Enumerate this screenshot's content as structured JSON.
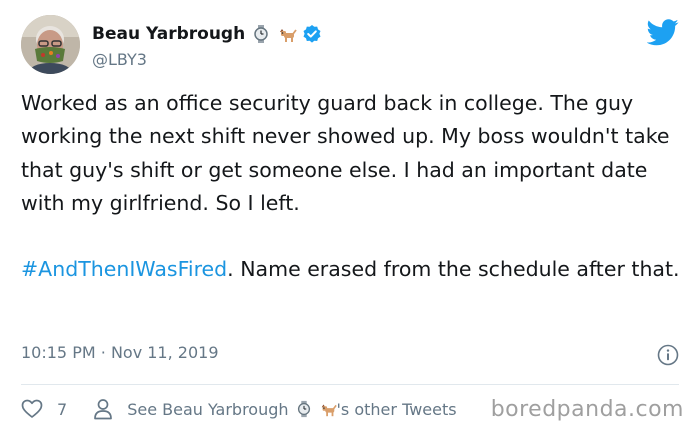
{
  "author": {
    "name": "Beau Yarbrough",
    "handle": "@LBY3",
    "emojis": [
      "watch-emoji",
      "dog-emoji"
    ],
    "verified": true
  },
  "tweet": {
    "text_main": "Worked as an office security guard back in college. The guy working the next shift never showed up. My boss wouldn't take that guy's shift or get someone else. I had an important date with my girlfriend. So I left.",
    "hashtag": "#AndThenIWasFired",
    "text_after": ". Name erased from the schedule after that.",
    "time": "10:15 PM",
    "separator": "·",
    "date": "Nov 11, 2019"
  },
  "actions": {
    "like_count": "7",
    "see_tweets_prefix": "See Beau Yarbrough",
    "see_tweets_suffix": "'s other Tweets"
  },
  "watermark": "boredpanda.com",
  "colors": {
    "twitter_blue": "#1da1f2",
    "hashtag_blue": "#1b95e0",
    "text": "#14171a",
    "muted": "#657786",
    "divider": "#e1e8ed"
  }
}
